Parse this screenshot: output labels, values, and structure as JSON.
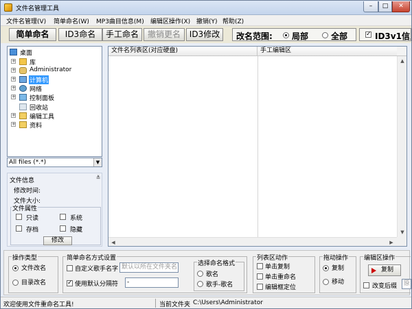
{
  "window": {
    "title": "文件名管理工具",
    "minimize_symbol": "–",
    "maximize_symbol": "□",
    "close_symbol": "✕"
  },
  "menu": [
    "文件名管理(V)",
    "简单命名(W)",
    "MP3曲目信息(M)",
    "编辑区操作(X)",
    "撤销(Y)",
    "帮助(Z)"
  ],
  "toolbar": {
    "buttons": [
      "简单命名",
      "ID3命名",
      "手工命名",
      "撤销更名",
      "ID3修改"
    ],
    "scope_label": "改名范围:",
    "scope_options": [
      "局部",
      "全部"
    ],
    "scope_selected": "局部",
    "id3_checked": true,
    "id3_label": "ID3v1信息"
  },
  "tree": [
    {
      "label": "桌面",
      "icon": "desktop-icon",
      "expander": false,
      "selected": false
    },
    {
      "label": "库",
      "icon": "library-icon",
      "expander": true,
      "selected": false
    },
    {
      "label": "Administrator",
      "icon": "user-icon",
      "expander": true,
      "selected": false
    },
    {
      "label": "计算机",
      "icon": "computer-icon",
      "expander": true,
      "selected": true
    },
    {
      "label": "网络",
      "icon": "network-icon",
      "expander": true,
      "selected": false
    },
    {
      "label": "控制面板",
      "icon": "control-panel-icon",
      "expander": true,
      "selected": false
    },
    {
      "label": "回收站",
      "icon": "recycle-bin-icon",
      "expander": false,
      "selected": false
    },
    {
      "label": "编辑工具",
      "icon": "folder-icon",
      "expander": true,
      "selected": false
    },
    {
      "label": "资料",
      "icon": "folder-icon",
      "expander": true,
      "selected": false
    }
  ],
  "filter": {
    "value": "All files (*.*)"
  },
  "file_info": {
    "title": "文件信息",
    "modified_label": "修改时间:",
    "size_label": "文件大小:",
    "attributes_title": "文件属性",
    "attributes": [
      "只读",
      "系统",
      "存档",
      "隐藏"
    ],
    "modify_button": "修改"
  },
  "grid": {
    "columns": [
      "文件名列表区(对应硬盘)",
      "手工编辑区"
    ]
  },
  "bottom": {
    "op_type": {
      "title": "操作类型",
      "options": [
        "文件改名",
        "目录改名"
      ],
      "selected": "文件改名"
    },
    "simple_naming": {
      "title": "简单命名方式设置",
      "custom_label": "自定义歌手名字",
      "custom_placeholder": "默认以所在文件夹名",
      "separator_label": "使用默认分隔符",
      "separator_value": "-",
      "custom_checked": false,
      "separator_checked": true
    },
    "format": {
      "title": "选择命名格式",
      "options": [
        "歌名",
        "歌手-歌名"
      ],
      "selected": ""
    },
    "list_actions": {
      "title": "列表区动作",
      "options": [
        "单击复制",
        "单击重命名",
        "编辑框定位"
      ]
    },
    "drag": {
      "title": "拖动操作",
      "options": [
        "复制",
        "移动"
      ],
      "selected": "复制"
    },
    "edit_ops": {
      "title": "编辑区操作",
      "copy_button": "复制",
      "change_label": "改变后缀",
      "suffix_value": "原"
    }
  },
  "status": {
    "message": "欢迎使用文件重命名工具!",
    "folder_label": "当前文件夹",
    "folder_path": "C:\\Users\\Administrator"
  }
}
